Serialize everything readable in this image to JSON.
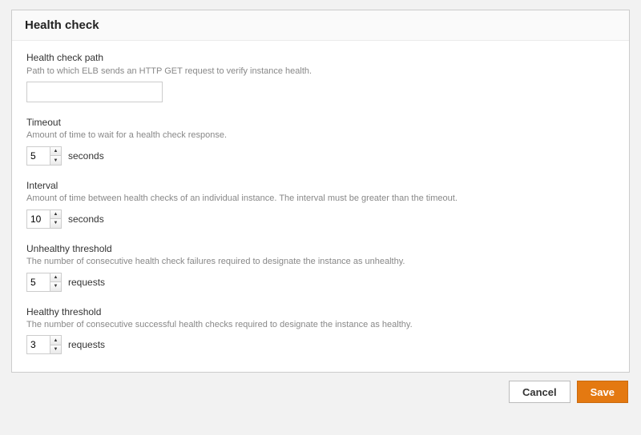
{
  "panel": {
    "title": "Health check"
  },
  "fields": {
    "path": {
      "label": "Health check path",
      "desc": "Path to which ELB sends an HTTP GET request to verify instance health.",
      "value": ""
    },
    "timeout": {
      "label": "Timeout",
      "desc": "Amount of time to wait for a health check response.",
      "value": "5",
      "unit": "seconds"
    },
    "interval": {
      "label": "Interval",
      "desc": "Amount of time between health checks of an individual instance. The interval must be greater than the timeout.",
      "value": "10",
      "unit": "seconds"
    },
    "unhealthy": {
      "label": "Unhealthy threshold",
      "desc": "The number of consecutive health check failures required to designate the instance as unhealthy.",
      "value": "5",
      "unit": "requests"
    },
    "healthy": {
      "label": "Healthy threshold",
      "desc": "The number of consecutive successful health checks required to designate the instance as healthy.",
      "value": "3",
      "unit": "requests"
    }
  },
  "buttons": {
    "cancel": "Cancel",
    "save": "Save"
  }
}
